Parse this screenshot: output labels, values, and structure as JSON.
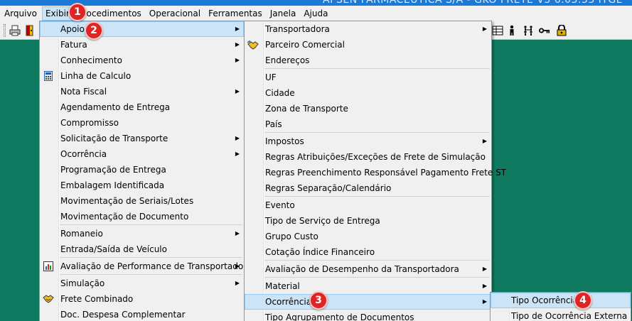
{
  "window": {
    "title": "APSEN FARMACEUTICA S/A - GKO FRETE V3 6.03.33 ITGL"
  },
  "menubar": {
    "items": [
      "Arquivo",
      "Exibir",
      "Procedimentos",
      "Operacional",
      "Ferramentas",
      "Janela",
      "Ajuda"
    ],
    "active": "Exibir"
  },
  "exibir_menu": {
    "items": [
      "Apoio",
      "Fatura",
      "Conhecimento",
      "Linha de Calculo",
      "Nota Fiscal",
      "Agendamento de Entrega",
      "Compromisso",
      "Solicitação de Transporte",
      "Ocorrência",
      "Programação de Entrega",
      "Embalagem Identificada",
      "Movimentação de Seriais/Lotes",
      "Movimentação de Documento",
      "Romaneio",
      "Entrada/Saída de Veículo",
      "Avaliação de Performance de Transportadora",
      "Simulação",
      "Frete Combinado",
      "Doc. Despesa Complementar"
    ],
    "highlighted": "Apoio"
  },
  "apoio_menu": {
    "items": [
      "Transportadora",
      "Parceiro Comercial",
      "Endereços",
      "UF",
      "Cidade",
      "Zona de Transporte",
      "País",
      "Impostos",
      "Regras Atribuições/Exceções de Frete de Simulação",
      "Regras Preenchimento Responsável Pagamento Frete ST",
      "Regras Separação/Calendário",
      "Evento",
      "Tipo de Serviço de Entrega",
      "Grupo Custo",
      "Cotação Índice Financeiro",
      "Avaliação de Desempenho da Transportadora",
      "Material",
      "Ocorrência",
      "Tipo Agrupamento de Documentos"
    ],
    "highlighted": "Ocorrência"
  },
  "ocorrencia_menu": {
    "items": [
      "Tipo Ocorrência",
      "Tipo de Ocorrência Externa"
    ],
    "highlighted": "Tipo Ocorrência"
  },
  "callouts": [
    "1",
    "2",
    "3",
    "4"
  ],
  "colors": {
    "workspace": "#0f7a5f",
    "highlight": "#cce4f7",
    "badge": "#e02424"
  }
}
